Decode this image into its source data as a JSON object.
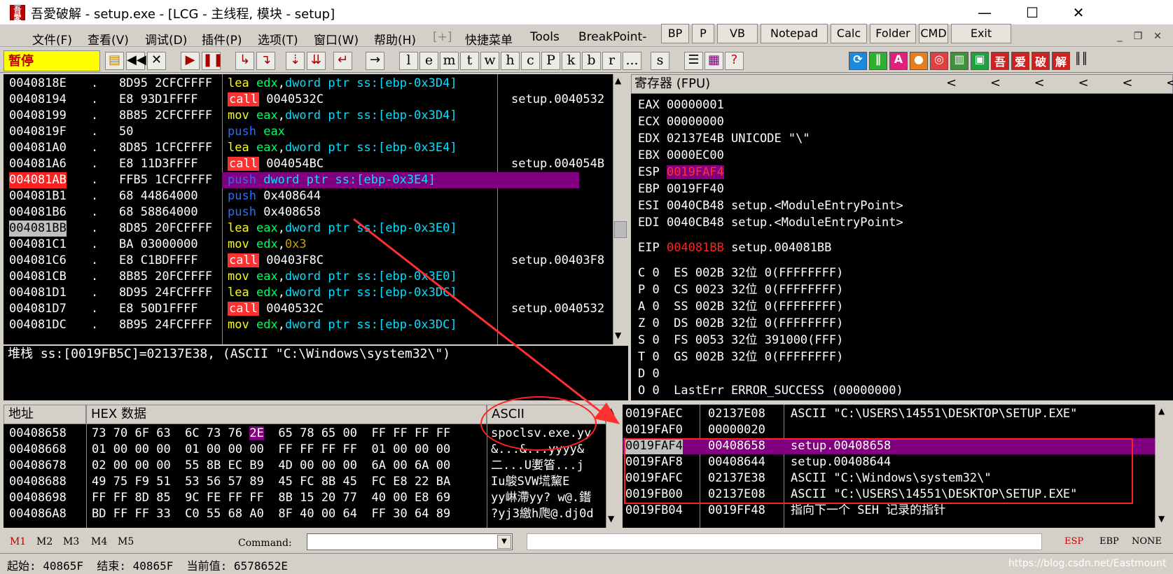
{
  "window": {
    "title": "吾愛破解 - setup.exe - [LCG -  主线程, 模块 - setup]",
    "icon_text": "吾愛",
    "minimize": "—",
    "maximize": "☐",
    "close": "✕"
  },
  "menu": [
    "文件(F)",
    "查看(V)",
    "调试(D)",
    "插件(P)",
    "选项(T)",
    "窗口(W)",
    "帮助(H)",
    "[+]",
    "快捷菜单",
    "Tools",
    "BreakPoint->"
  ],
  "plugin_buttons": [
    "BP",
    "P",
    "VB",
    "Notepad",
    "Calc",
    "Folder",
    "CMD",
    "Exit"
  ],
  "toolbar": {
    "status": "暂停",
    "letters": [
      "l",
      "e",
      "m",
      "t",
      "w",
      "h",
      "c",
      "P",
      "k",
      "b",
      "r",
      "...",
      "s"
    ],
    "right_icons": [
      "吾",
      "爱",
      "破",
      "解"
    ]
  },
  "disasm": [
    {
      "addr": "0040818E",
      "dot": ".",
      "hex": "8D95 2CFCFFFF",
      "mn": "lea",
      "ops": "edx,dword ptr ss:[ebp-0x3D4]",
      "cmt": ""
    },
    {
      "addr": "00408194",
      "dot": ".",
      "hex": "E8 93D1FFFF",
      "mn": "call",
      "ops": "0040532C",
      "cmt": "setup.0040532"
    },
    {
      "addr": "00408199",
      "dot": ".",
      "hex": "8B85 2CFCFFFF",
      "mn": "mov",
      "ops": "eax,dword ptr ss:[ebp-0x3D4]",
      "cmt": ""
    },
    {
      "addr": "0040819F",
      "dot": ".",
      "hex": "50",
      "mn": "push",
      "ops": "eax",
      "cmt": ""
    },
    {
      "addr": "004081A0",
      "dot": ".",
      "hex": "8D85 1CFCFFFF",
      "mn": "lea",
      "ops": "eax,dword ptr ss:[ebp-0x3E4]",
      "cmt": ""
    },
    {
      "addr": "004081A6",
      "dot": ".",
      "hex": "E8 11D3FFFF",
      "mn": "call",
      "ops": "004054BC",
      "cmt": "setup.004054B"
    },
    {
      "addr": "004081AB",
      "dot": ".",
      "hex": "FFB5 1CFCFFFF",
      "mn": "push",
      "ops": "dword ptr ss:[ebp-0x3E4]",
      "cmt": ""
    },
    {
      "addr": "004081B1",
      "dot": ".",
      "hex": "68 44864000",
      "mn": "push",
      "ops": "0x408644",
      "cmt": ""
    },
    {
      "addr": "004081B6",
      "dot": ".",
      "hex": "68 58864000",
      "mn": "push",
      "ops": "0x408658",
      "cmt": ""
    },
    {
      "addr": "004081BB",
      "dot": ".",
      "hex": "8D85 20FCFFFF",
      "mn": "lea",
      "ops": "eax,dword ptr ss:[ebp-0x3E0]",
      "cmt": ""
    },
    {
      "addr": "004081C1",
      "dot": ".",
      "hex": "BA 03000000",
      "mn": "mov",
      "ops": "edx,0x3",
      "cmt": ""
    },
    {
      "addr": "004081C6",
      "dot": ".",
      "hex": "E8 C1BDFFFF",
      "mn": "call",
      "ops": "00403F8C",
      "cmt": "setup.00403F8"
    },
    {
      "addr": "004081CB",
      "dot": ".",
      "hex": "8B85 20FCFFFF",
      "mn": "mov",
      "ops": "eax,dword ptr ss:[ebp-0x3E0]",
      "cmt": ""
    },
    {
      "addr": "004081D1",
      "dot": ".",
      "hex": "8D95 24FCFFFF",
      "mn": "lea",
      "ops": "edx,dword ptr ss:[ebp-0x3DC]",
      "cmt": ""
    },
    {
      "addr": "004081D7",
      "dot": ".",
      "hex": "E8 50D1FFFF",
      "mn": "call",
      "ops": "0040532C",
      "cmt": "setup.0040532"
    },
    {
      "addr": "004081DC",
      "dot": ".",
      "hex": "8B95 24FCFFFF",
      "mn": "mov",
      "ops": "edx,dword ptr ss:[ebp-0x3DC]",
      "cmt": ""
    }
  ],
  "info_line": "堆栈 ss:[0019FB5C]=02137E38, (ASCII \"C:\\Windows\\system32\\\")",
  "registers": {
    "header": "寄存器 (FPU)",
    "arrows": [
      "<",
      "<",
      "<",
      "<",
      "<",
      "<"
    ],
    "rows": [
      "EAX 00000001",
      "ECX 00000000",
      "EDX 02137E4B UNICODE \"\\\"",
      "EBX 0000EC00",
      "ESP 0019FAF4",
      "EBP 0019FF40",
      "ESI 0040CB48 setup.<ModuleEntryPoint>",
      "EDI 0040CB48 setup.<ModuleEntryPoint>"
    ],
    "eip_label": "EIP",
    "eip_value": "004081BB",
    "eip_comment": "setup.004081BB",
    "flags": [
      "C 0  ES 002B 32位 0(FFFFFFFF)",
      "P 0  CS 0023 32位 0(FFFFFFFF)",
      "A 0  SS 002B 32位 0(FFFFFFFF)",
      "Z 0  DS 002B 32位 0(FFFFFFFF)",
      "S 0  FS 0053 32位 391000(FFF)",
      "T 0  GS 002B 32位 0(FFFFFFFF)",
      "D 0",
      "O 0  LastErr ERROR_SUCCESS (00000000)"
    ]
  },
  "dump": {
    "h_addr": "地址",
    "h_hex": "HEX 数据",
    "h_ascii": "ASCII",
    "rows": [
      {
        "addr": "00408658",
        "hex": "73 70 6F 63 6C 73 76 2E 65 78 65 00 FF FF FF FF",
        "ascii": "spoclsv.exe.yy"
      },
      {
        "addr": "00408668",
        "hex": "01 00 00 00 01 00 00 00 FF FF FF FF 01 00 00 00",
        "ascii": "&...&...yyyy&"
      },
      {
        "addr": "00408678",
        "hex": "02 00 00 00 55 8B EC B9 4D 00 00 00 6A 00 6A 00",
        "ascii": "二...U嬱箵...j"
      },
      {
        "addr": "00408688",
        "hex": "49 75 F9 51 53 56 57 89 45 FC 8B 45 FC E8 22 BA",
        "ascii": "Iu鵔SVW塃黧E"
      },
      {
        "addr": "00408698",
        "hex": "FF FF 8D 85 9C FE FF FF 8B 15 20 77 40 00 E8 69",
        "ascii": "yy崊滯yy? w@.鑙"
      },
      {
        "addr": "004086A8",
        "hex": "BD FF FF 33 C0 55 68 A0 8F 40 00 64 FF 30 64 89",
        "ascii": "?yj3繳h爮@.dj0d"
      }
    ]
  },
  "stack": [
    {
      "addr": "0019FAEC",
      "val": "02137E08",
      "cmt": "ASCII \"C:\\USERS\\14551\\DESKTOP\\SETUP.EXE\""
    },
    {
      "addr": "0019FAF0",
      "val": "00000020",
      "cmt": ""
    },
    {
      "addr": "0019FAF4",
      "val": "00408658",
      "cmt": "setup.00408658"
    },
    {
      "addr": "0019FAF8",
      "val": "00408644",
      "cmt": "setup.00408644"
    },
    {
      "addr": "0019FAFC",
      "val": "02137E38",
      "cmt": "ASCII \"C:\\Windows\\system32\\\""
    },
    {
      "addr": "0019FB00",
      "val": "02137E08",
      "cmt": "ASCII \"C:\\USERS\\14551\\DESKTOP\\SETUP.EXE\""
    },
    {
      "addr": "0019FB04",
      "val": "0019FF48",
      "cmt": "指向下一个 SEH 记录的指针"
    }
  ],
  "command_bar": {
    "tabs": [
      "M1",
      "M2",
      "M3",
      "M4",
      "M5"
    ],
    "label": "Command:",
    "value": "",
    "reg_tabs": [
      "ESP",
      "EBP",
      "NONE"
    ]
  },
  "statusbar": {
    "text": "起始: 40865F  结束: 40865F  当前值: 6578652E",
    "watermark": "https://blog.csdn.net/Eastmount"
  },
  "colors": {
    "selection": "#800080",
    "breakpoint": "#ff2020",
    "annotation": "#ff2020"
  }
}
